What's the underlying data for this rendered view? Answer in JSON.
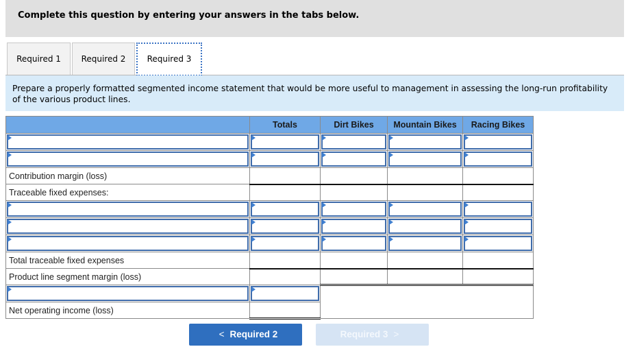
{
  "header": {
    "title": "Complete this question by entering your answers in the tabs below."
  },
  "tabs": [
    {
      "label": "Required 1",
      "active": false
    },
    {
      "label": "Required 2",
      "active": false
    },
    {
      "label": "Required 3",
      "active": true
    }
  ],
  "instruction": "Prepare a properly formatted segmented income statement that would be more useful to management in assessing the long-run profitability of the various product lines.",
  "table": {
    "columns": [
      "",
      "Totals",
      "Dirt Bikes",
      "Mountain Bikes",
      "Racing Bikes"
    ],
    "rows": [
      {
        "type": "input",
        "label": "",
        "values": [
          "",
          "",
          "",
          ""
        ]
      },
      {
        "type": "input",
        "label": "",
        "values": [
          "",
          "",
          "",
          ""
        ]
      },
      {
        "type": "static",
        "label": "Contribution margin (loss)",
        "values": [
          "",
          "",
          "",
          ""
        ]
      },
      {
        "type": "static",
        "label": "Traceable fixed expenses:",
        "values": [
          "",
          "",
          "",
          ""
        ]
      },
      {
        "type": "input",
        "label": "",
        "values": [
          "",
          "",
          "",
          ""
        ]
      },
      {
        "type": "input",
        "label": "",
        "values": [
          "",
          "",
          "",
          ""
        ]
      },
      {
        "type": "input",
        "label": "",
        "values": [
          "",
          "",
          "",
          ""
        ]
      },
      {
        "type": "static",
        "label": "Total traceable fixed expenses",
        "values": [
          "",
          "",
          "",
          ""
        ]
      },
      {
        "type": "static",
        "label": "Product line segment margin (loss)",
        "values": [
          "",
          "",
          "",
          ""
        ]
      },
      {
        "type": "input",
        "label": "",
        "values": [
          ""
        ]
      },
      {
        "type": "static",
        "label": "Net operating income (loss)",
        "values": [
          ""
        ]
      }
    ]
  },
  "nav": {
    "prev_label": "Required 2",
    "next_label": "Required 3",
    "prev_icon": "chevron-left-icon",
    "next_icon": "chevron-right-icon",
    "next_disabled": true
  },
  "colors": {
    "header_bg": "#e0e0e0",
    "instruction_bg": "#d8ebf9",
    "table_header_bg": "#6fa8e6",
    "input_border": "#3f6cab",
    "prev_button": "#2f6fbf",
    "next_button_disabled": "#d6e4f4"
  }
}
